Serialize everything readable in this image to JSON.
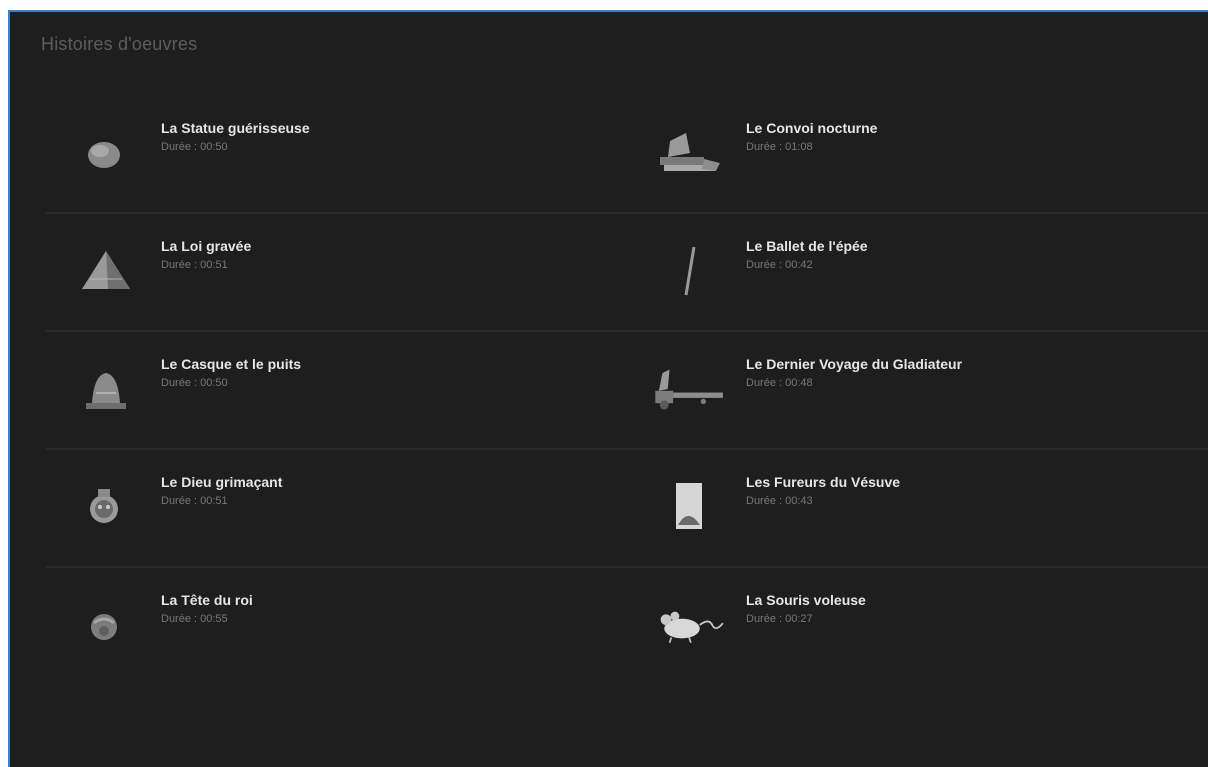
{
  "section_title": "Histoires d'oeuvres",
  "rows": [
    {
      "left": {
        "title": "La Statue guérisseuse",
        "duration": "Durée : 00:50",
        "icon": "statue-icon"
      },
      "right": {
        "title": "Le Convoi nocturne",
        "duration": "Durée : 01:08",
        "icon": "convoy-icon"
      }
    },
    {
      "left": {
        "title": "La Loi gravée",
        "duration": "Durée : 00:51",
        "icon": "pyramid-icon"
      },
      "right": {
        "title": "Le Ballet de l'épée",
        "duration": "Durée : 00:42",
        "icon": "sword-icon"
      }
    },
    {
      "left": {
        "title": "Le Casque et le puits",
        "duration": "Durée : 00:50",
        "icon": "helmet-icon"
      },
      "right": {
        "title": "Le Dernier Voyage du Gladiateur",
        "duration": "Durée : 00:48",
        "icon": "chariot-icon"
      }
    },
    {
      "left": {
        "title": "Le Dieu grimaçant",
        "duration": "Durée : 00:51",
        "icon": "grimacing-god-icon"
      },
      "right": {
        "title": "Les Fureurs du Vésuve",
        "duration": "Durée : 00:43",
        "icon": "volcano-icon"
      }
    },
    {
      "left": {
        "title": "La Tête du roi",
        "duration": "Durée : 00:55",
        "icon": "king-head-icon"
      },
      "right": {
        "title": "La Souris voleuse",
        "duration": "Durée : 00:27",
        "icon": "mouse-icon"
      }
    }
  ]
}
